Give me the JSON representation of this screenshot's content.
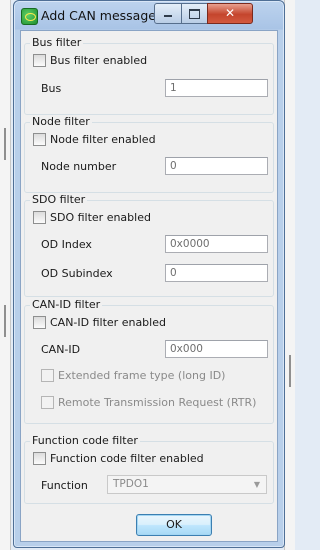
{
  "window": {
    "title": "Add CAN message filter",
    "controls": {
      "minimize": "minimize",
      "maximize": "maximize",
      "close": "✕"
    }
  },
  "groups": {
    "bus": {
      "title": "Bus filter",
      "enable_label": "Bus filter enabled",
      "enabled": false,
      "fields": [
        {
          "label": "Bus",
          "value": "1"
        }
      ]
    },
    "node": {
      "title": "Node filter",
      "enable_label": "Node filter enabled",
      "enabled": false,
      "fields": [
        {
          "label": "Node number",
          "value": "0"
        }
      ]
    },
    "sdo": {
      "title": "SDO filter",
      "enable_label": "SDO filter enabled",
      "enabled": false,
      "fields": [
        {
          "label": "OD Index",
          "value": "0x0000"
        },
        {
          "label": "OD Subindex",
          "value": "0"
        }
      ]
    },
    "canid": {
      "title": "CAN-ID filter",
      "enable_label": "CAN-ID filter enabled",
      "enabled": false,
      "fields": [
        {
          "label": "CAN-ID",
          "value": "0x000"
        }
      ],
      "extended_label": "Extended frame type (long ID)",
      "rtr_label": "Remote Transmission Request (RTR)"
    },
    "function": {
      "title": "Function code filter",
      "enable_label": "Function code filter enabled",
      "enabled": false,
      "field_label": "Function",
      "selected": "TPDO1"
    }
  },
  "buttons": {
    "ok": "OK"
  },
  "icons": {
    "app": "app-icon",
    "dropdown": "chevron-down-icon"
  },
  "colors": {
    "titlebar": "#b8cfea",
    "client": "#f0f0f0",
    "close": "#c4452d",
    "ok_border": "#3c7fb1"
  }
}
